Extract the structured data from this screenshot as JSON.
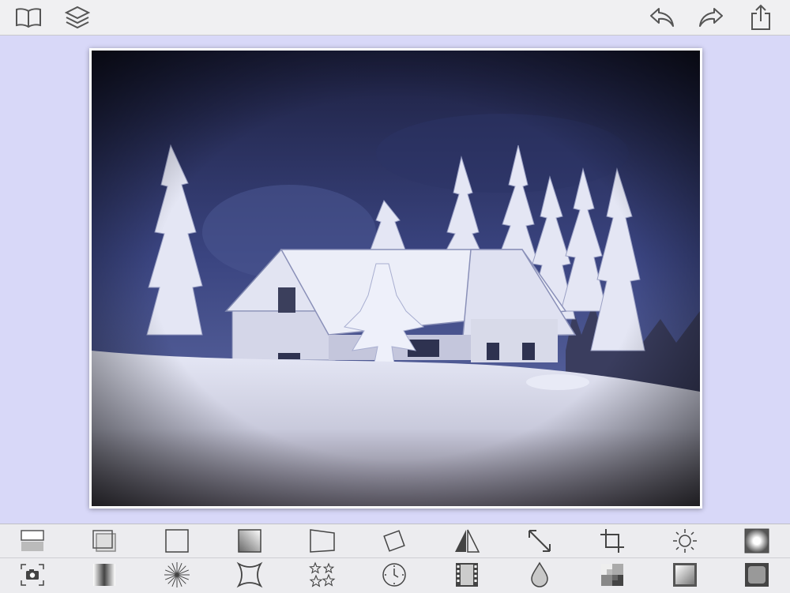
{
  "toolbar": {
    "left": [
      {
        "id": "library",
        "icon": "book-icon"
      },
      {
        "id": "layers",
        "icon": "layers-icon"
      }
    ],
    "right": [
      {
        "id": "undo",
        "icon": "undo-arrow-icon"
      },
      {
        "id": "redo",
        "icon": "redo-arrow-icon"
      },
      {
        "id": "share",
        "icon": "share-icon"
      }
    ]
  },
  "canvas": {
    "background_color": "#d8d8f8",
    "photo": {
      "subject": "snow-covered-cabin-winter-scene",
      "frame_color": "#ffffff"
    }
  },
  "tools_row1": [
    "split-frame-icon",
    "double-border-icon",
    "square-frame-icon",
    "gradient-frame-icon",
    "perspective-icon",
    "rotate-icon",
    "mirror-icon",
    "resize-arrows-icon",
    "crop-icon",
    "brightness-icon",
    "vignette-icon"
  ],
  "tools_row2": [
    "camera-icon",
    "gradient-bar-icon",
    "starburst-icon",
    "concave-frame-icon",
    "stars-icon",
    "clock-icon",
    "film-strip-icon",
    "droplet-icon",
    "checker-icon",
    "soft-frame-icon",
    "rounded-frame-icon"
  ]
}
